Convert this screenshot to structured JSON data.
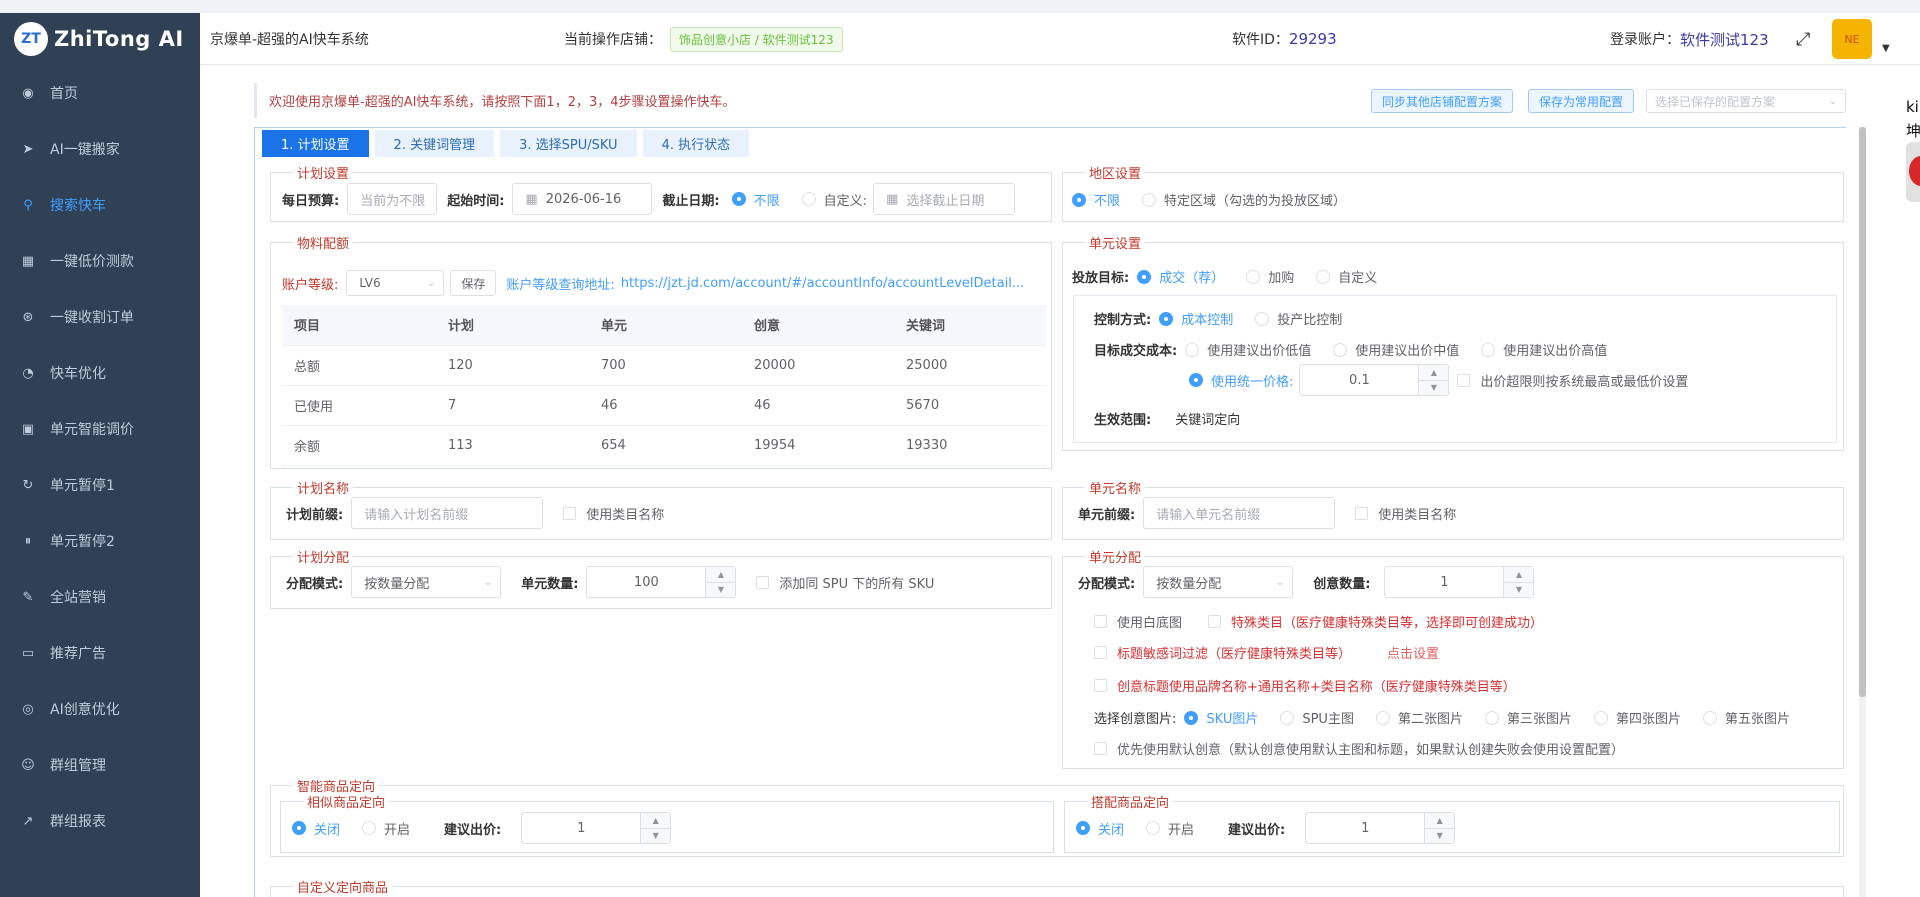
{
  "sidebar": {
    "logo_mark": "ZT",
    "logo_text": "ZhiTong AI",
    "items": [
      {
        "label": "首页",
        "icon": "dashboard-icon",
        "glyph": "◉"
      },
      {
        "label": "AI一键搬家",
        "icon": "send-icon",
        "glyph": "➤"
      },
      {
        "label": "搜索快车",
        "icon": "search-icon",
        "glyph": "⚲"
      },
      {
        "label": "一键低价测款",
        "icon": "grid-icon",
        "glyph": "▦"
      },
      {
        "label": "一键收割订单",
        "icon": "coin-icon",
        "glyph": "⊛"
      },
      {
        "label": "快车优化",
        "icon": "gauge-icon",
        "glyph": "◔"
      },
      {
        "label": "单元智能调价",
        "icon": "tablet-icon",
        "glyph": "▣"
      },
      {
        "label": "单元暂停1",
        "icon": "refresh-icon",
        "glyph": "↻"
      },
      {
        "label": "单元暂停2",
        "icon": "pause-icon",
        "glyph": "⏸"
      },
      {
        "label": "全站营销",
        "icon": "edit-icon",
        "glyph": "✎"
      },
      {
        "label": "推荐广告",
        "icon": "monitor-icon",
        "glyph": "▭"
      },
      {
        "label": "AI创意优化",
        "icon": "compass-icon",
        "glyph": "◎"
      },
      {
        "label": "群组管理",
        "icon": "users-icon",
        "glyph": "☺"
      },
      {
        "label": "群组报表",
        "icon": "chart-icon",
        "glyph": "↗"
      }
    ]
  },
  "header": {
    "system_title": "京爆单-超强的AI快车系统",
    "shop_label": "当前操作店铺：",
    "shop_name": "饰品创意小店 / 软件测试123",
    "software_id_label": "软件ID：",
    "software_id": "29293",
    "account_label": "登录账户：",
    "account_name": "软件测试123",
    "avatar_text": "NE"
  },
  "edge": {
    "line1": "ki",
    "line2": "坤"
  },
  "notice": {
    "text": "欢迎使用京爆单-超强的AI快车系统，请按照下面1，2，3，4步骤设置操作快车。",
    "sync_button": "同步其他店铺配置方案",
    "save_common_button": "保存为常用配置",
    "config_placeholder": "选择已保存的配置方案"
  },
  "tabs": [
    "1. 计划设置",
    "2. 关键词管理",
    "3. 选择SPU/SKU",
    "4. 执行状态"
  ],
  "plan_settings": {
    "legend": "计划设置",
    "budget_label": "每日预算:",
    "budget_placeholder": "当前为不限",
    "start_label": "起始时间:",
    "start_value": "2026-06-16",
    "end_label": "截止日期:",
    "end_unlimited": "不限",
    "end_custom": "自定义:",
    "end_placeholder": "选择截止日期"
  },
  "region": {
    "legend": "地区设置",
    "unlimited": "不限",
    "specific": "特定区域（勾选的为投放区域）"
  },
  "material": {
    "legend": "物料配额",
    "level_label": "账户等级:",
    "level_value": "LV6",
    "save_label": "保存",
    "query_label": "账户等级查询地址:",
    "query_url": "https://jzt.jd.com/account/#/accountInfo/accountLevelDetail...",
    "headers": [
      "项目",
      "计划",
      "单元",
      "创意",
      "关键词"
    ],
    "rows": [
      [
        "总额",
        "120",
        "700",
        "20000",
        "25000"
      ],
      [
        "已使用",
        "7",
        "46",
        "46",
        "5670"
      ],
      [
        "余额",
        "113",
        "654",
        "19954",
        "19330"
      ]
    ]
  },
  "unit_settings": {
    "legend": "单元设置",
    "target_label": "投放目标:",
    "target_options": [
      "成交（荐）",
      "加购",
      "自定义"
    ],
    "control_label": "控制方式:",
    "control_options": [
      "成本控制",
      "投产比控制"
    ],
    "cost_label": "目标成交成本:",
    "cost_options": [
      "使用建议出价低值",
      "使用建议出价中值",
      "使用建议出价高值"
    ],
    "unified_label": "使用统一价格:",
    "unified_value": "0.1",
    "over_limit_label": "出价超限则按系统最高或最低价设置",
    "scope_label": "生效范围:",
    "scope_value": "关键词定向"
  },
  "plan_name": {
    "legend": "计划名称",
    "prefix_label": "计划前缀:",
    "prefix_placeholder": "请输入计划名前缀",
    "use_category": "使用类目名称"
  },
  "unit_name": {
    "legend": "单元名称",
    "prefix_label": "单元前缀:",
    "prefix_placeholder": "请输入单元名前缀",
    "use_category": "使用类目名称"
  },
  "plan_alloc": {
    "legend": "计划分配",
    "mode_label": "分配模式:",
    "mode_value": "按数量分配",
    "count_label": "单元数量:",
    "count_value": "100",
    "add_same_spu": "添加同 SPU 下的所有 SKU"
  },
  "unit_alloc": {
    "legend": "单元分配",
    "mode_label": "分配模式:",
    "mode_value": "按数量分配",
    "creative_label": "创意数量:",
    "creative_value": "1",
    "white_bg": "使用白底图",
    "special_category": "特殊类目（医疗健康特殊类目等，选择即可创建成功）",
    "sensitive_filter": "标题敏感词过滤（医疗健康特殊类目等）",
    "click_setting": "点击设置",
    "creative_title": "创意标题使用品牌名称+通用名称+类目名称（医疗健康特殊类目等）",
    "image_label": "选择创意图片:",
    "image_options": [
      "SKU图片",
      "SPU主图",
      "第二张图片",
      "第三张图片",
      "第四张图片",
      "第五张图片"
    ],
    "default_creative": "优先使用默认创意（默认创意使用默认主图和标题，如果默认创建失败会使用设置配置）"
  },
  "smart_targeting": {
    "legend": "智能商品定向",
    "similar_legend": "相似商品定向",
    "similar_off": "关闭",
    "similar_on": "开启",
    "similar_bid_label": "建议出价:",
    "similar_bid": "1",
    "match_legend": "搭配商品定向",
    "match_off": "关闭",
    "match_on": "开启",
    "match_bid_label": "建议出价:",
    "match_bid": "1"
  },
  "custom_targeting": {
    "legend": "自定义定向商品"
  },
  "colors": {
    "sidebar_bg": "#304156",
    "accent": "#409eff",
    "legend_red": "#c0392b",
    "tab_active": "#1a73e8"
  }
}
